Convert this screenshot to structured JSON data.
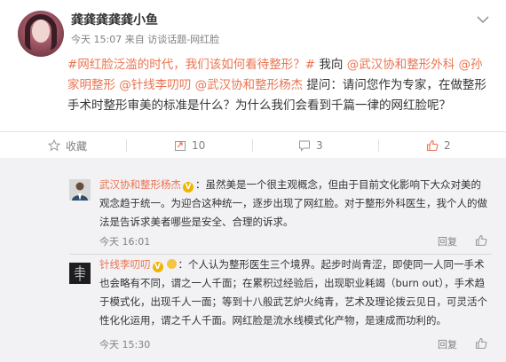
{
  "post": {
    "author": "龚龚龚龚龚小鱼",
    "meta": "今天 15:07 来自 访谈话题-网红脸",
    "body_topic": "#网红脸泛滥的时代，我们该如何看待整形？#",
    "body_text1": " 我向 ",
    "body_mention1": "@武汉协和整形外科",
    "body_mention2": "@孙家明整形",
    "body_mention3": "@针线李叨叨",
    "body_mention4": "@武汉协和整形杨杰",
    "body_text2": " 提问：请问您作为专家，在做整形手术时整形审美的标准是什么？为什么我们会看到千篇一律的网红脸呢？"
  },
  "actions": {
    "collect": "收藏",
    "repost": "10",
    "comment": "3",
    "like": "2"
  },
  "comments": [
    {
      "name": "武汉协和整形杨杰",
      "badge": "V",
      "text": "：虽然美是一个很主观概念，但由于目前文化影响下大众对美的观念趋于统一。为迎合这种统一，逐步出现了网红脸。对于整形外科医生，我个人的做法是告诉求美者哪些是安全、合理的诉求。",
      "time": "今天 16:01",
      "reply": "回复"
    },
    {
      "name": "针线李叨叨",
      "badge": "V",
      "text": "：个人认为整形医生三个境界。起步时尚青涩，即使同一人同一手术也会略有不同，谓之一人千面；在累积过经验后，出现职业耗竭（burn out），手术趋于模式化，出现千人一面；等到十八般武艺炉火纯青，艺术及理论拨云见日，可灵活个性化化运用，谓之千人千面。网红脸是流水线模式化产物，是速成而功利的。",
      "time": "今天 15:30",
      "reply": "回复"
    }
  ],
  "icons": {
    "more": "chevron-down-icon",
    "collect": "star-icon",
    "repost": "repost-icon",
    "comment": "comment-icon",
    "like": "thumbs-up-icon",
    "comment_like": "thumbs-up-icon"
  },
  "colors": {
    "link": "#eb7350",
    "text": "#333333",
    "meta": "#808080",
    "comment_bg": "#f2f2f5",
    "badge": "#f0b400"
  }
}
